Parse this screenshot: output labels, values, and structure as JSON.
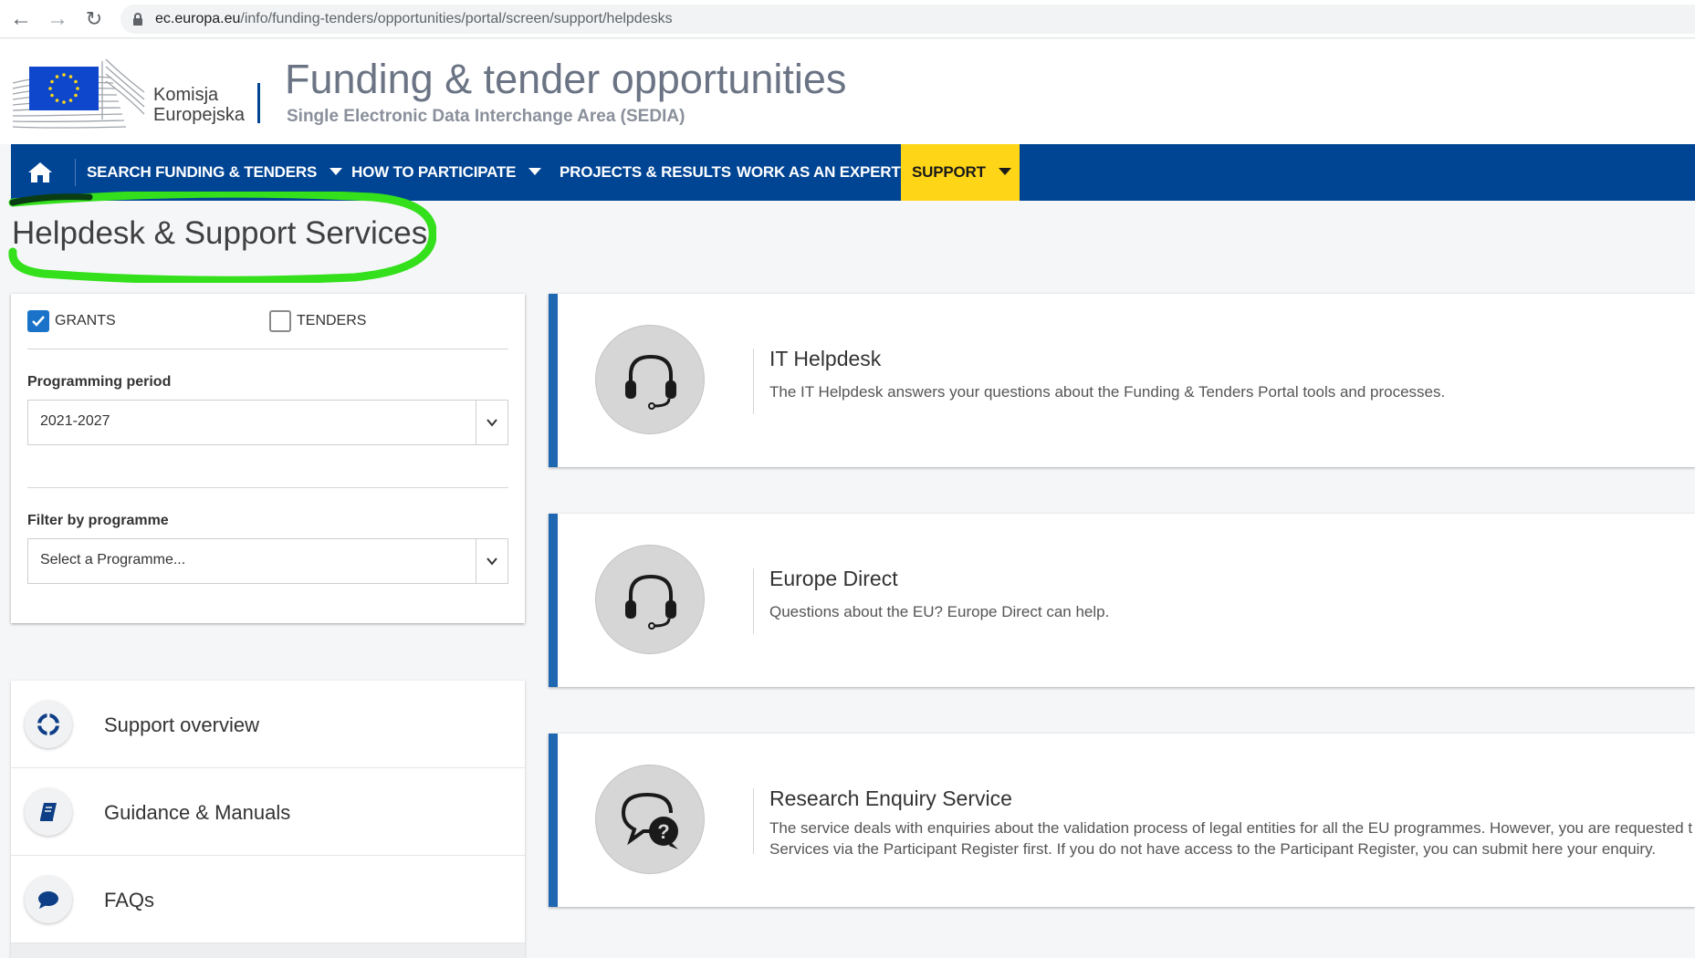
{
  "browser": {
    "url_domain": "ec.europa.eu",
    "url_path": "/info/funding-tenders/opportunities/portal/screen/support/helpdesks"
  },
  "header": {
    "org_line1": "Komisja",
    "org_line2": "Europejska",
    "title": "Funding & tender opportunities",
    "subtitle": "Single Electronic Data Interchange Area (SEDIA)"
  },
  "nav": {
    "items": [
      {
        "label": "SEARCH FUNDING & TENDERS",
        "dropdown": true
      },
      {
        "label": "HOW TO PARTICIPATE",
        "dropdown": true
      },
      {
        "label": "PROJECTS & RESULTS",
        "dropdown": false
      },
      {
        "label": "WORK AS AN EXPERT",
        "dropdown": false
      },
      {
        "label": "SUPPORT",
        "dropdown": true,
        "active": true
      }
    ],
    "active_color": "#ffd617",
    "bar_color": "#004494"
  },
  "page": {
    "title": "Helpdesk & Support Services"
  },
  "filters": {
    "grants_label": "GRANTS",
    "grants_checked": true,
    "tenders_label": "TENDERS",
    "tenders_checked": false,
    "period_label": "Programming period",
    "period_value": "2021-2027",
    "programme_label": "Filter by programme",
    "programme_placeholder": "Select a Programme..."
  },
  "leftmenu": {
    "items": [
      {
        "label": "Support overview",
        "icon": "lifebuoy-icon"
      },
      {
        "label": "Guidance & Manuals",
        "icon": "book-icon"
      },
      {
        "label": "FAQs",
        "icon": "speech-bubble-icon"
      }
    ]
  },
  "cards": [
    {
      "title": "IT Helpdesk",
      "description_lines": [
        "The IT Helpdesk answers your questions about the Funding & Tenders Portal tools and processes."
      ],
      "icon": "headset-icon"
    },
    {
      "title": "Europe Direct",
      "description_lines": [
        "Questions about the EU? Europe Direct can help."
      ],
      "icon": "headset-icon"
    },
    {
      "title": "Research Enquiry Service",
      "description_lines": [
        "The service deals with enquiries about the validation process of legal entities for all the EU programmes. However, you are requested t",
        "Services via the Participant Register first. If you do not have access to the Participant Register, you can submit here your enquiry."
      ],
      "icon": "question-chat-icon"
    }
  ]
}
